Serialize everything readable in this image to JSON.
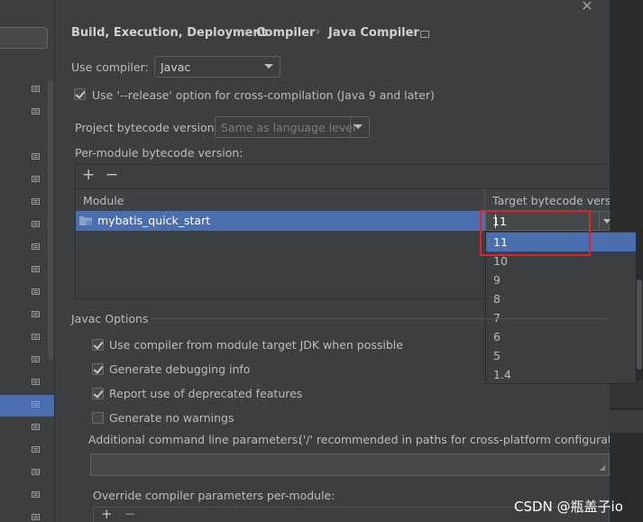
{
  "breadcrumb": {
    "items": [
      "Build, Execution, Deployment",
      "Compiler",
      "Java Compiler"
    ],
    "separator": "›"
  },
  "compiler": {
    "label": "Use compiler:",
    "value": "Javac"
  },
  "release_option": {
    "label": "Use '--release' option for cross-compilation (Java 9 and later)",
    "checked": true
  },
  "project_bytecode": {
    "label": "Project bytecode version:",
    "placeholder": "Same as language level"
  },
  "per_module": {
    "label": "Per-module bytecode version:",
    "add_label": "+",
    "remove_label": "−",
    "columns": [
      "Module",
      "Target bytecode version"
    ],
    "rows": [
      {
        "module": "mybatis_quick_start",
        "target": "11"
      }
    ],
    "editor_value": "11",
    "dropdown_options": [
      "11",
      "10",
      "9",
      "8",
      "7",
      "6",
      "5",
      "1.4"
    ],
    "selected_option": "11"
  },
  "javac_options": {
    "title": "Javac Options",
    "checkboxes": [
      {
        "label": "Use compiler from module target JDK when possible",
        "checked": true
      },
      {
        "label": "Generate debugging info",
        "checked": true
      },
      {
        "label": "Report use of deprecated features",
        "checked": true
      },
      {
        "label": "Generate no warnings",
        "checked": false
      }
    ],
    "additional_params_label": "Additional command line parameters:",
    "additional_params_hint": "('/' recommended in paths for cross-platform configurations)",
    "additional_params_value": "",
    "override_label": "Override compiler parameters per-module:",
    "override_add": "+",
    "override_remove": "−"
  },
  "watermark": "CSDN @瓶盖子io",
  "colors": {
    "background": "#3c3f41",
    "selection": "#4b6eaf",
    "highlight_box": "#e0232b"
  }
}
